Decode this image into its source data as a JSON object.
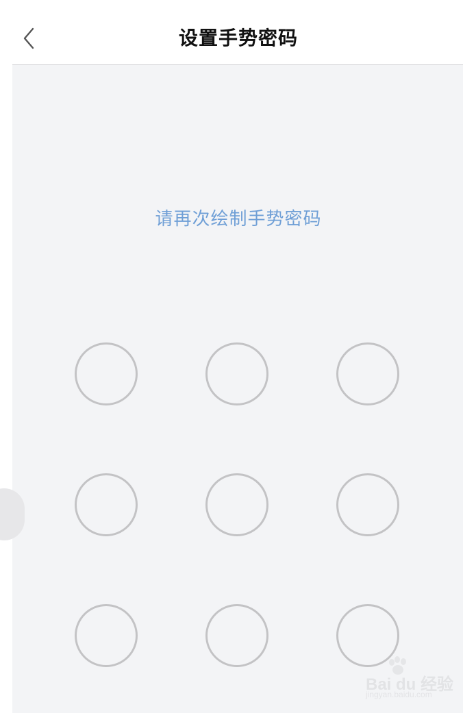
{
  "header": {
    "title": "设置手势密码",
    "back_icon": "chevron-left-icon"
  },
  "main": {
    "hint": "请再次绘制手势密码",
    "hint_color": "#6f9fd6",
    "pattern_dots": [
      1,
      2,
      3,
      4,
      5,
      6,
      7,
      8,
      9
    ],
    "pattern_dot_color": "#c3c3c5",
    "background_color": "#f3f4f6"
  },
  "watermark": {
    "main_text": "Bai du 经验",
    "sub_text": "jingyan.baidu.com",
    "icon": "paw-icon"
  }
}
